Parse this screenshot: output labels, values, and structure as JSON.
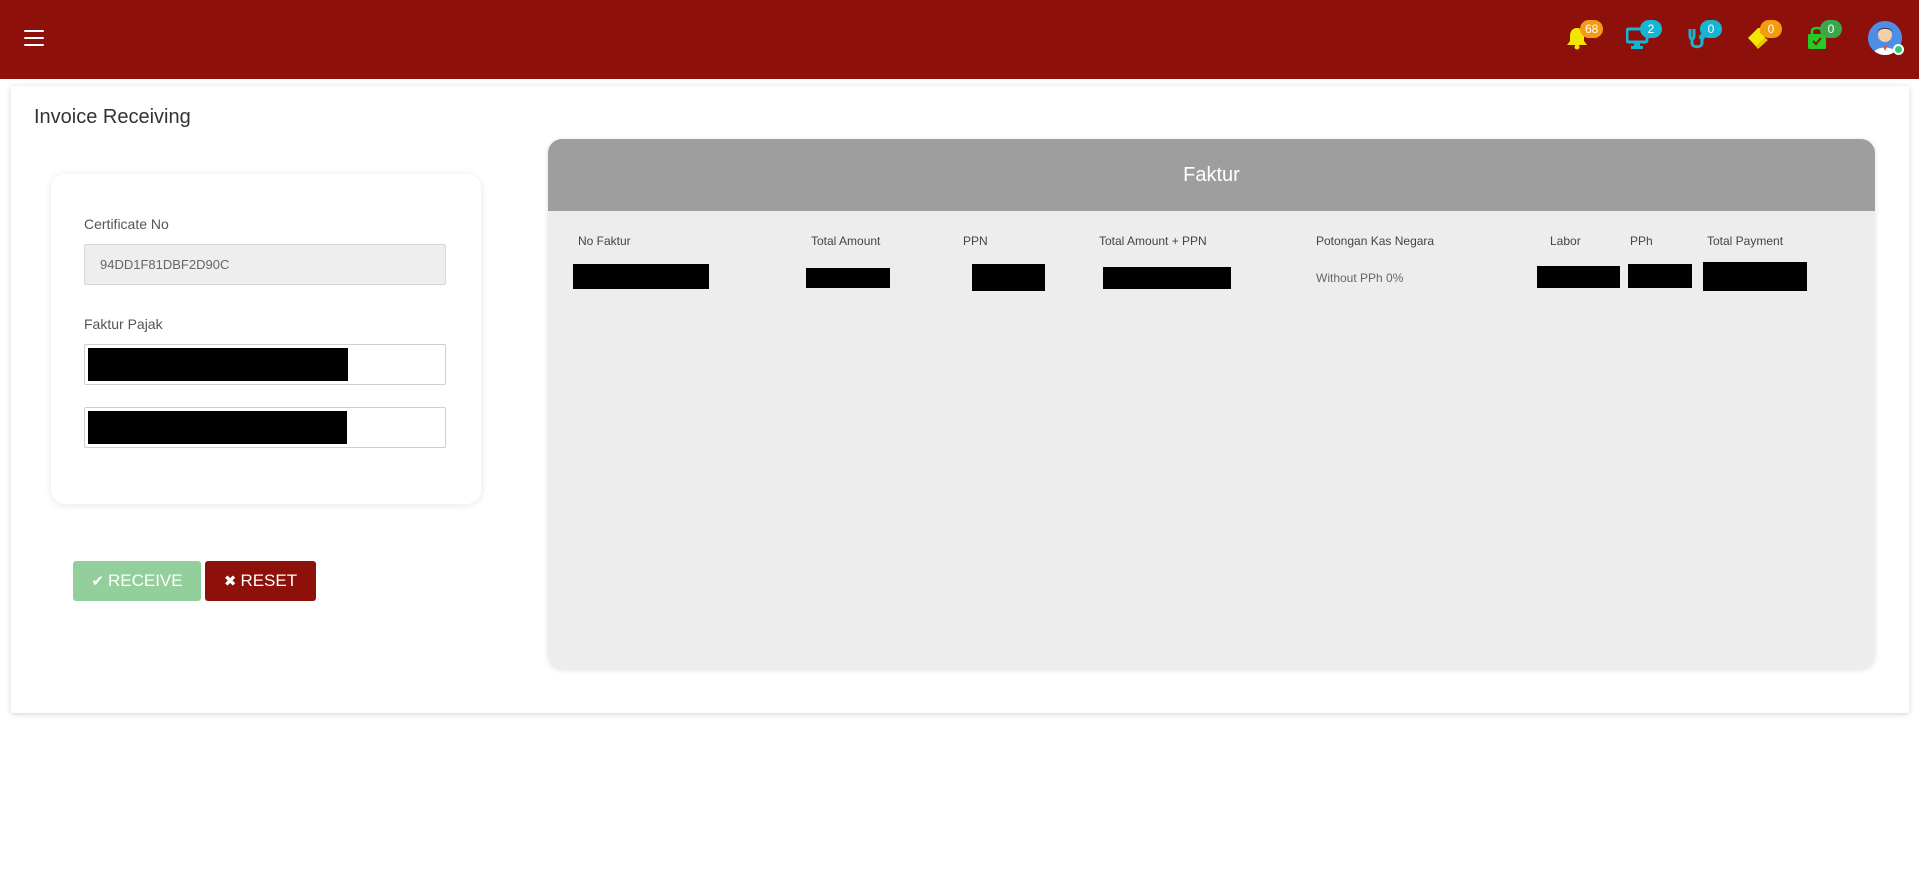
{
  "header": {
    "notifications": [
      {
        "name": "bell-icon",
        "count": "68",
        "color": "#f5e600",
        "badge": "orange"
      },
      {
        "name": "monitor-icon",
        "count": "2",
        "color": "#17b5d4",
        "badge": "cyan"
      },
      {
        "name": "stethoscope-icon",
        "count": "0",
        "color": "#17b5d4",
        "badge": "cyan"
      },
      {
        "name": "tags-icon",
        "count": "0",
        "color": "#f5e600",
        "badge": "orange"
      },
      {
        "name": "shopping-bag-icon",
        "count": "0",
        "color": "#22cc22",
        "badge": "green"
      }
    ]
  },
  "page": {
    "title": "Invoice Receiving"
  },
  "form": {
    "certificate_label": "Certificate No",
    "certificate_value": "94DD1F81DBF2D90C",
    "faktur_label": "Faktur Pajak"
  },
  "buttons": {
    "receive_label": "RECEIVE",
    "reset_label": "RESET"
  },
  "faktur": {
    "title": "Faktur",
    "columns": [
      "No Faktur",
      "Total Amount",
      "PPN",
      "Total Amount + PPN",
      "Potongan Kas Negara",
      "Labor",
      "PPh",
      "Total Payment"
    ],
    "row": {
      "potongan": "Without PPh 0%"
    }
  },
  "colors": {
    "topbar": "#8e100a",
    "receive": "#93cf9b",
    "reset": "#8e100a",
    "faktur_header": "#9e9e9e"
  }
}
